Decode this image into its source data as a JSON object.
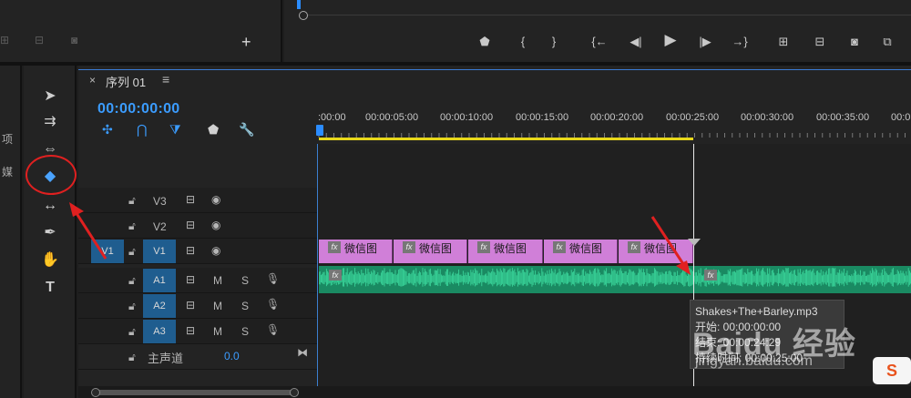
{
  "colors": {
    "accent": "#3b9cff",
    "video_clip": "#d07fd8",
    "audio_clip": "#1a8a62",
    "work_area": "#e8d81a",
    "annotation": "#e02020"
  },
  "program_monitor": {
    "controls": [
      "marker-icon",
      "mark-in-icon",
      "mark-out-icon",
      "go-to-in-icon",
      "step-back-icon",
      "play-icon",
      "step-forward-icon",
      "go-to-out-icon",
      "lift-icon",
      "extract-icon",
      "export-frame-icon",
      "compare-icon"
    ]
  },
  "project_edge": {
    "chars": [
      "项",
      "媒"
    ]
  },
  "tools": [
    {
      "name": "selection-tool",
      "glyph": "➤"
    },
    {
      "name": "track-select-tool",
      "glyph": "⇉"
    },
    {
      "name": "ripple-edit-tool",
      "glyph": "⇔"
    },
    {
      "name": "razor-tool",
      "glyph": "◆"
    },
    {
      "name": "slip-tool",
      "glyph": "↔"
    },
    {
      "name": "pen-tool",
      "glyph": "✒"
    },
    {
      "name": "hand-tool",
      "glyph": "✋"
    },
    {
      "name": "type-tool",
      "glyph": "T"
    }
  ],
  "timeline": {
    "close": "×",
    "title": "序列 01",
    "menu": "≡",
    "timecode": "00:00:00:00",
    "ruler_labels": [
      ":00:00",
      "00:00:05:00",
      "00:00:10:00",
      "00:00:15:00",
      "00:00:20:00",
      "00:00:25:00",
      "00:00:30:00",
      "00:00:35:00",
      "00:0"
    ]
  },
  "tracks": {
    "video": [
      {
        "target": "V3",
        "source": ""
      },
      {
        "target": "V2",
        "source": ""
      },
      {
        "target": "V1",
        "source": "V1"
      }
    ],
    "audio": [
      {
        "target": "A1",
        "m": "M",
        "s": "S"
      },
      {
        "target": "A2",
        "m": "M",
        "s": "S"
      },
      {
        "target": "A3",
        "m": "M",
        "s": "S"
      }
    ],
    "master": {
      "label": "主声道",
      "value": "0.0"
    }
  },
  "video_clips": [
    {
      "label": "微信图"
    },
    {
      "label": "微信图"
    },
    {
      "label": "微信图"
    },
    {
      "label": "微信图"
    },
    {
      "label": "微信图"
    }
  ],
  "fx_badge": "fx",
  "tooltip": {
    "name": "Shakes+The+Barley.mp3",
    "start": "开始: 00:00:00:00",
    "end": "结束: 00:00:24:29",
    "duration": "持续时间: 00:00:25:00"
  },
  "watermark": {
    "brand": "Baidu 经验",
    "url": "jingyan.baidu.com",
    "so": "S"
  }
}
